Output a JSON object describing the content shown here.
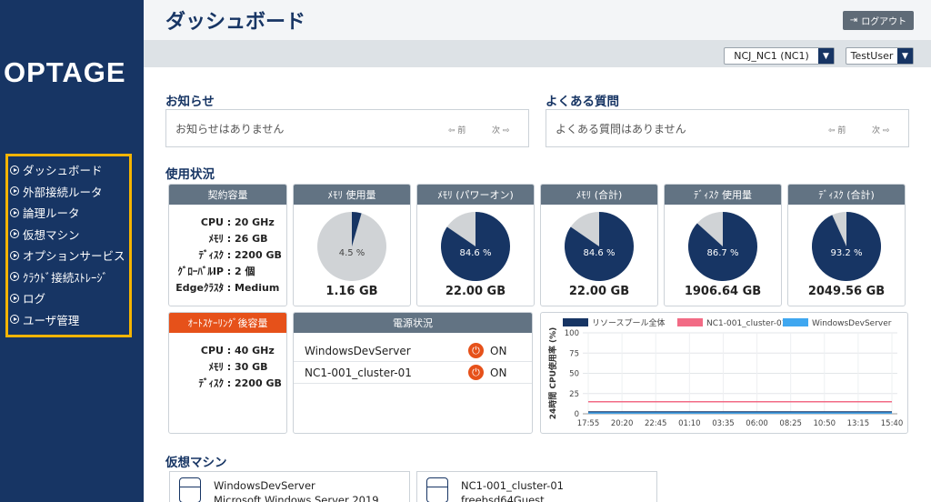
{
  "brand": {
    "logo_text": "OPTAGE"
  },
  "sidebar": {
    "items": [
      {
        "label": "ダッシュボード"
      },
      {
        "label": "外部接続ルータ"
      },
      {
        "label": "論理ルータ"
      },
      {
        "label": "仮想マシン"
      },
      {
        "label": "オプションサービス"
      },
      {
        "label": "ｸﾗｳﾄﾞ接続ｽﾄﾚｰｼﾞ"
      },
      {
        "label": "ログ"
      },
      {
        "label": "ユーザ管理"
      }
    ]
  },
  "header": {
    "title": "ダッシュボード",
    "logout_label": "ログアウト",
    "tenant_select": "NCJ_NC1 (NC1)",
    "user_select": "TestUser"
  },
  "notice": {
    "title": "お知らせ",
    "empty": "お知らせはありません",
    "prev": "前",
    "next": "次"
  },
  "faq": {
    "title": "よくある質問",
    "empty": "よくある質問はありません",
    "prev": "前",
    "next": "次"
  },
  "usage": {
    "title": "使用状況",
    "contract": {
      "header": "契約容量",
      "rows": [
        {
          "k": "CPU",
          "v": "20 GHz"
        },
        {
          "k": "ﾒﾓﾘ",
          "v": "26 GB"
        },
        {
          "k": "ﾃﾞｨｽｸ",
          "v": "2200 GB"
        },
        {
          "k": "ｸﾞﾛｰﾊﾞﾙIP",
          "v": "2 個"
        },
        {
          "k": "Edgeｸﾗｽﾀ",
          "v": "Medium"
        }
      ]
    },
    "pies": [
      {
        "header": "ﾒﾓﾘ 使用量",
        "percent": 4.5,
        "pct_label": "4.5 %",
        "value": "1.16 GB"
      },
      {
        "header": "ﾒﾓﾘ (パワーオン)",
        "percent": 84.6,
        "pct_label": "84.6 %",
        "value": "22.00 GB"
      },
      {
        "header": "ﾒﾓﾘ (合計)",
        "percent": 84.6,
        "pct_label": "84.6 %",
        "value": "22.00 GB"
      },
      {
        "header": "ﾃﾞｨｽｸ 使用量",
        "percent": 86.7,
        "pct_label": "86.7 %",
        "value": "1906.64 GB"
      },
      {
        "header": "ﾃﾞｨｽｸ (合計)",
        "percent": 93.2,
        "pct_label": "93.2 %",
        "value": "2049.56 GB"
      }
    ],
    "autoscale": {
      "header": "ｵｰﾄｽｹｰﾘﾝｸﾞ後容量",
      "rows": [
        {
          "k": "CPU",
          "v": "40 GHz"
        },
        {
          "k": "ﾒﾓﾘ",
          "v": "30 GB"
        },
        {
          "k": "ﾃﾞｨｽｸ",
          "v": "2200 GB"
        }
      ]
    },
    "power": {
      "header": "電源状況",
      "rows": [
        {
          "name": "WindowsDevServer",
          "status": "ON"
        },
        {
          "name": "NC1-001_cluster-01",
          "status": "ON"
        }
      ]
    }
  },
  "colors": {
    "navy": "#173564",
    "pie_empty": "#d0d3d6",
    "orange": "#e6511a",
    "series_pool": "#173564",
    "series_cluster": "#f26b85",
    "series_win": "#3fa7f0"
  },
  "chart_data": {
    "type": "line",
    "ylabel": "24時間 CPU使用率 (%)",
    "ylim": [
      0,
      100
    ],
    "yticks": [
      0,
      25,
      50,
      75,
      100
    ],
    "x": [
      "17:55",
      "20:20",
      "22:45",
      "01:10",
      "03:35",
      "06:00",
      "08:25",
      "10:50",
      "13:15",
      "15:40"
    ],
    "series": [
      {
        "name": "リソースプール全体",
        "values": [
          2,
          2,
          2,
          2,
          2,
          2,
          2,
          2,
          2,
          2
        ]
      },
      {
        "name": "NC1-001_cluster-01",
        "values": [
          15,
          15,
          15,
          15,
          15,
          15,
          15,
          15,
          15,
          15
        ]
      },
      {
        "name": "WindowsDevServer",
        "values": [
          1,
          1,
          1,
          1,
          1,
          1,
          1,
          1,
          1,
          1
        ]
      }
    ]
  },
  "vm": {
    "title": "仮想マシン",
    "cards": [
      {
        "name": "WindowsDevServer",
        "os": "Microsoft Windows Server 2019"
      },
      {
        "name": "NC1-001_cluster-01",
        "os": "freebsd64Guest"
      }
    ]
  }
}
